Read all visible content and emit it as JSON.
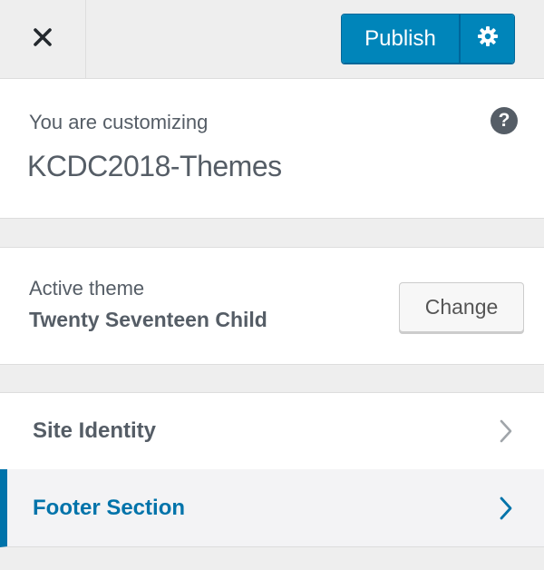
{
  "header": {
    "close_label": "×",
    "publish_label": "Publish",
    "settings_icon": "gear-icon",
    "accent_color": "#0085ba"
  },
  "info": {
    "action": "You are customizing",
    "site_title": "KCDC2018-Themes",
    "help_label": "?"
  },
  "theme": {
    "label": "Active theme",
    "name": "Twenty Seventeen Child",
    "change_label": "Change"
  },
  "sections": [
    {
      "label": "Site Identity",
      "icon": "chevron-right-icon",
      "active": false
    },
    {
      "label": "Footer Section",
      "icon": "chevron-right-icon",
      "active": true,
      "active_color": "#0073aa"
    }
  ]
}
